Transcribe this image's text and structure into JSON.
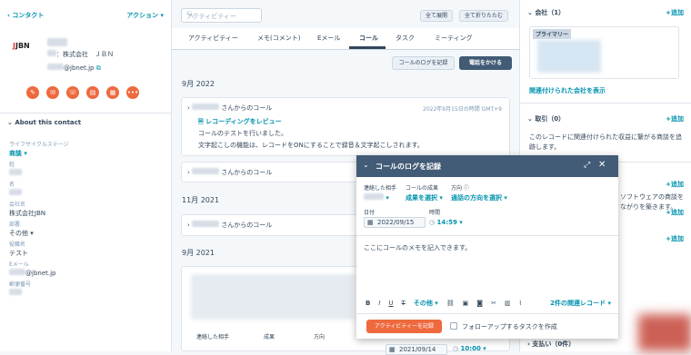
{
  "left": {
    "back_label": "‹ コンタクト",
    "actions_label": "アクション ▾",
    "company_line": "：株式会社　ＪＢＮ",
    "email_suffix": "@jbnet.jp",
    "about_title": "About this contact",
    "props": [
      {
        "label": "ライフサイクルステージ",
        "value": "商談 ▾",
        "link": true
      },
      {
        "label": "姓",
        "value": ""
      },
      {
        "label": "名",
        "value": ""
      },
      {
        "label": "会社名",
        "value": "株式会社JBN"
      },
      {
        "label": "部署",
        "value": "その他 ▾"
      },
      {
        "label": "役職名",
        "value": "テスト"
      },
      {
        "label": "Eメール",
        "value": "@jbnet.jp"
      },
      {
        "label": "郵便番号",
        "value": ""
      }
    ],
    "logo_text": "JBN"
  },
  "mid": {
    "search_placeholder": "アクティビティー",
    "expand_all": "全て展開",
    "collapse_all": "全て折りたたむ",
    "tabs": [
      "アクティビティー",
      "メモ(コメント)",
      "Eメール",
      "コール",
      "タスク",
      "ミーティング"
    ],
    "log_call": "コールのログを記録",
    "make_call": "電話をかける",
    "month1": "9月 2022",
    "card1": {
      "from": "さんからのコール",
      "time": "2022年9月15日の時間 GMT+9",
      "review": "レコーディングをレビュー",
      "line1": "コールのテストを行いました。",
      "line2": "文字起こしの機能は、レコードをONにすることで録音＆文字起こしされます。"
    },
    "card2_from": "さんからのコール",
    "month2": "11月 2021",
    "card3_from": "さんからのコール",
    "month3": "9月 2021",
    "bottom_labels": [
      "連絡した相手",
      "成果",
      "方向"
    ]
  },
  "right": {
    "company_title": "会社（1）",
    "add": "+追加",
    "primary_badge": "プライマリー",
    "view_companies": "関連付けられた会社を表示",
    "deals_title": "取引（0）",
    "deals_text": "このレコードに関連付けられた収益に繋がる商談を追跡します。",
    "partial1": "ソフトウェアの商談を",
    "partial2": "ながりを築きます。",
    "payments_title": "支払い（0件）"
  },
  "modal": {
    "title": "コールのログを記録",
    "contact_label": "連絡した相手",
    "outcome_label": "コールの成果",
    "outcome_value": "成果を選択 ▾",
    "direction_label": "方向",
    "direction_value": "通話の方向を選択 ▾",
    "date_label": "日付",
    "date_value": "2022/09/15",
    "time_label": "時間",
    "time_value": "14:59 ▾",
    "note": "ここにコールのメモを記入できます。",
    "more_label": "その他 ▾",
    "assoc_label": "2件の関連レコード ▾",
    "save_label": "アクティビティーを記録",
    "followup_label": "フォローアップするタスクを作成",
    "bottom_date": "2021/09/14",
    "bottom_time": "10:00 ▾"
  },
  "colors": {
    "orange": "#ee6a3e",
    "navy": "#425b76",
    "link": "#0091ae"
  }
}
